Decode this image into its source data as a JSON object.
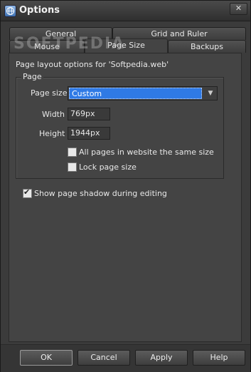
{
  "window": {
    "title": "Options",
    "close_glyph": "✕",
    "app_icon": "globe-icon",
    "watermark": "SOFTPEDIA"
  },
  "tabs": {
    "row1": [
      {
        "label": "General"
      },
      {
        "label": "Grid and Ruler"
      }
    ],
    "row2": [
      {
        "label": "Mouse"
      },
      {
        "label": "Page Size",
        "active": true
      },
      {
        "label": "Backups"
      }
    ]
  },
  "content": {
    "intro": "Page layout options for 'Softpedia.web'",
    "group_title": "Page",
    "page_size_label": "Page size",
    "page_size_value": "Custom",
    "width_label": "Width",
    "width_value": "769px",
    "height_label": "Height",
    "height_value": "1944px",
    "all_pages_label": "All pages in website the same size",
    "all_pages_checked": false,
    "lock_label": "Lock page size",
    "lock_checked": false,
    "shadow_label": "Show page shadow during editing",
    "shadow_checked": true
  },
  "buttons": {
    "ok": "OK",
    "cancel": "Cancel",
    "apply": "Apply",
    "help": "Help"
  },
  "colors": {
    "selection": "#2f7ae5",
    "background": "#3b3b3b"
  }
}
